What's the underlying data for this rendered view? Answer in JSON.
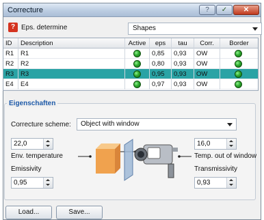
{
  "window": {
    "title": "Correcture"
  },
  "eps_row": {
    "label": "Eps. determine",
    "shapes_value": "Shapes"
  },
  "table": {
    "headers": {
      "id": "ID",
      "description": "Description",
      "active": "Active",
      "eps": "eps",
      "tau": "tau",
      "corr": "Corr.",
      "border": "Border"
    },
    "rows": [
      {
        "id": "R1",
        "description": "R1",
        "eps": "0,85",
        "tau": "0,93",
        "corr": "OW",
        "active": true,
        "border": true,
        "selected": false
      },
      {
        "id": "R2",
        "description": "R2",
        "eps": "0,80",
        "tau": "0,93",
        "corr": "OW",
        "active": true,
        "border": true,
        "selected": false
      },
      {
        "id": "R3",
        "description": "R3",
        "eps": "0,95",
        "tau": "0,93",
        "corr": "OW",
        "active": true,
        "border": true,
        "selected": true
      },
      {
        "id": "E4",
        "description": "E4",
        "eps": "0,97",
        "tau": "0,93",
        "corr": "OW",
        "active": true,
        "border": true,
        "selected": false
      }
    ]
  },
  "properties": {
    "title": "Eigenschaften",
    "scheme_label": "Correcture scheme:",
    "scheme_value": "Object with window",
    "env_temp_value": "22,0",
    "env_temp_label": "Env. temperature",
    "emissivity_label": "Emissivity",
    "emissivity_value": "0,95",
    "window_temp_value": "16,0",
    "window_temp_label": "Temp. out of window",
    "transmissivity_label": "Transmissivity",
    "transmissivity_value": "0,93"
  },
  "buttons": {
    "load": "Load...",
    "save": "Save..."
  },
  "colors": {
    "selection": "#2aa3a5",
    "group_title": "#1e5aa8",
    "close_button": "#c0391e"
  }
}
